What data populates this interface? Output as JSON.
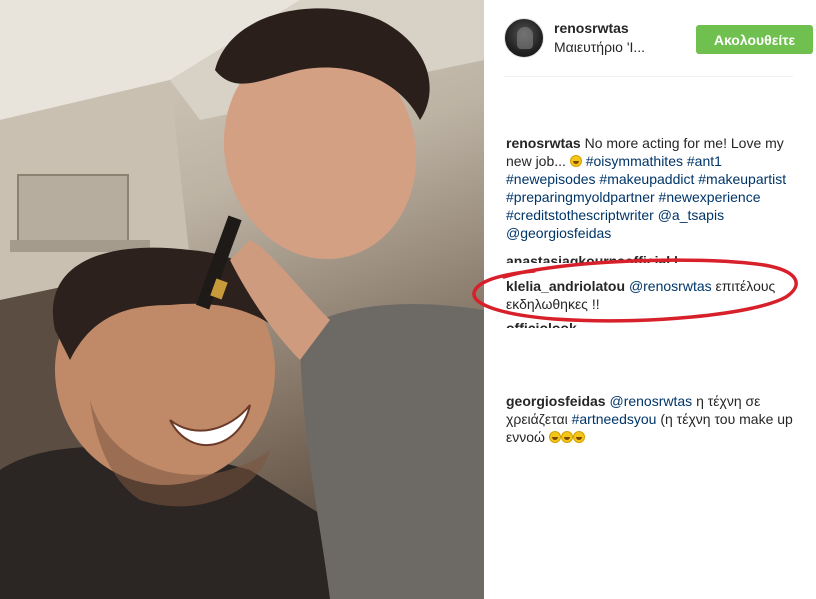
{
  "post": {
    "username": "renosrwtas",
    "location": "Μαιευτήριο 'Ι...",
    "follow_label": "Ακολουθείτε"
  },
  "caption": {
    "user": "renosrwtas",
    "text": "No more acting for me! Love my new job...",
    "tags": [
      "#oisymmathites",
      "#ant1",
      "#newepisodes",
      "#makeupaddict",
      "#makeupartist",
      "#preparingmyoldpartner",
      "#newexperience",
      "#creditstothescriptwriter",
      "@a_tsapis",
      "@georgiosfeidas"
    ]
  },
  "partial_rows": {
    "row1": "anastasiagkournaofficial | ...",
    "row2": "officiolook"
  },
  "comments": [
    {
      "user": "klelia_andriolatou",
      "mention": "@renosrwtas",
      "text": "επιτέλους εκδηλωθηκες !!"
    },
    {
      "user": "georgiosfeidas",
      "mention": "@renosrwtas",
      "text_before": "η τέχνη σε χρειάζεται",
      "tag": "#artneedsyou",
      "text_after": "(η τέχνη του make up εννοώ"
    }
  ],
  "colors": {
    "follow_button": "#70c050",
    "hashtag": "#003569",
    "highlight_ellipse": "#d8202a"
  },
  "icons": {
    "avatar": "profile-avatar",
    "emoji": "grinning-face-emoji"
  }
}
